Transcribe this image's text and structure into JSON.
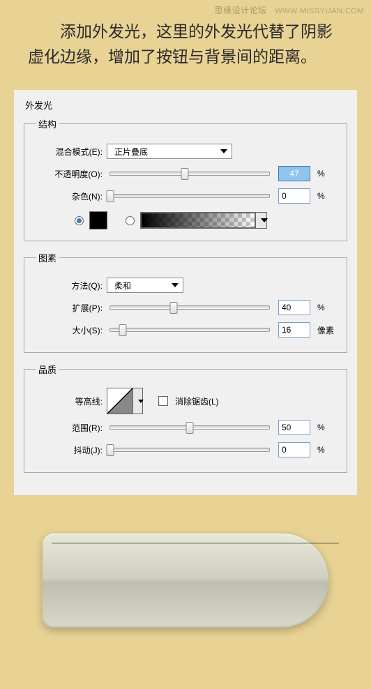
{
  "watermark": {
    "brand": "思缘设计论坛",
    "url": "WWW.MISSYUAN.COM"
  },
  "description": "添加外发光，这里的外发光代替了阴影虚化边缘，增加了按钮与背景间的距离。",
  "panel": {
    "title": "外发光",
    "structure": {
      "legend": "结构",
      "blend_label": "混合模式(E):",
      "blend_value": "正片叠底",
      "opacity_label": "不透明度(O):",
      "opacity_value": "47",
      "opacity_unit": "%",
      "noise_label": "杂色(N):",
      "noise_value": "0",
      "noise_unit": "%"
    },
    "elements": {
      "legend": "图素",
      "method_label": "方法(Q):",
      "method_value": "柔和",
      "spread_label": "扩展(P):",
      "spread_value": "40",
      "spread_unit": "%",
      "size_label": "大小(S):",
      "size_value": "16",
      "size_unit": "像素"
    },
    "quality": {
      "legend": "品质",
      "contour_label": "等高线:",
      "antialias_label": "消除锯齿(L)",
      "range_label": "范围(R):",
      "range_value": "50",
      "range_unit": "%",
      "jitter_label": "抖动(J):",
      "jitter_value": "0",
      "jitter_unit": "%"
    }
  },
  "chart_data": null
}
